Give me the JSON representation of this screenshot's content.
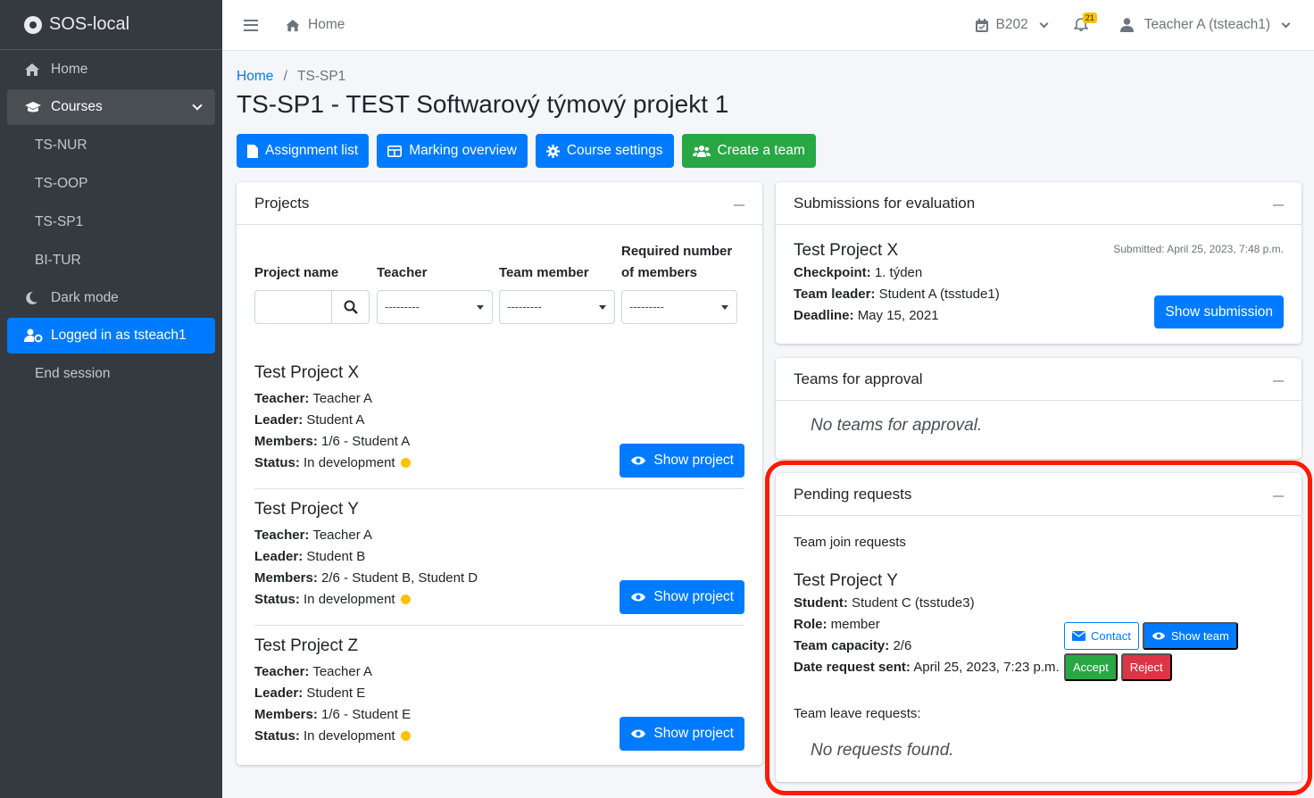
{
  "sidebar": {
    "brand": "SOS-local",
    "items": [
      {
        "label": "Home",
        "icon": "home-icon"
      },
      {
        "label": "Courses",
        "icon": "graduation-cap-icon"
      },
      {
        "label": "TS-NUR"
      },
      {
        "label": "TS-OOP"
      },
      {
        "label": "TS-SP1"
      },
      {
        "label": "BI-TUR"
      },
      {
        "label": "Dark mode",
        "icon": "moon-icon"
      },
      {
        "label": "Logged in as tsteach1",
        "icon": "user-cog-icon"
      },
      {
        "label": "End session"
      }
    ]
  },
  "topbar": {
    "home_label": "Home",
    "room": "B202",
    "notifications_count": "21",
    "user": "Teacher A (tsteach1)"
  },
  "breadcrumb": {
    "home": "Home",
    "current": "TS-SP1"
  },
  "page_title": "TS-SP1 - TEST Softwarový týmový projekt 1",
  "actions": {
    "assignment_list": "Assignment list",
    "marking_overview": "Marking overview",
    "course_settings": "Course settings",
    "create_team": "Create a team"
  },
  "projects": {
    "title": "Projects",
    "filters": {
      "project_name": "Project name",
      "teacher": "Teacher",
      "team_member": "Team member",
      "required_line1": "Required number",
      "required_line2": "of members",
      "placeholder": "---------"
    },
    "labels": {
      "teacher": "Teacher:",
      "leader": "Leader:",
      "members": "Members:",
      "status": "Status:"
    },
    "show_label": "Show project",
    "list": [
      {
        "name": "Test Project X",
        "teacher": "Teacher A",
        "leader": "Student A",
        "members": "1/6 - Student A",
        "status": "In development"
      },
      {
        "name": "Test Project Y",
        "teacher": "Teacher A",
        "leader": "Student B",
        "members": "2/6 - Student B, Student D",
        "status": "In development"
      },
      {
        "name": "Test Project Z",
        "teacher": "Teacher A",
        "leader": "Student E",
        "members": "1/6 - Student E",
        "status": "In development"
      }
    ]
  },
  "submissions": {
    "title": "Submissions for evaluation",
    "project": "Test Project X",
    "submitted": "Submitted: April 25, 2023, 7:48 p.m.",
    "checkpoint_label": "Checkpoint:",
    "checkpoint": "1. týden",
    "leader_label": "Team leader:",
    "leader": "Student A (tsstude1)",
    "deadline_label": "Deadline:",
    "deadline": "May 15, 2021",
    "button": "Show submission"
  },
  "approval": {
    "title": "Teams for approval",
    "empty": "No teams for approval."
  },
  "pending": {
    "title": "Pending requests",
    "join_title": "Team join requests",
    "project": "Test Project Y",
    "student_label": "Student:",
    "student": "Student C (tsstude3)",
    "role_label": "Role:",
    "role": "member",
    "capacity_label": "Team capacity:",
    "capacity": "2/6",
    "date_label": "Date request sent:",
    "date": "April 25, 2023, 7:23 p.m.",
    "contact": "Contact",
    "show_team": "Show team",
    "accept": "Accept",
    "reject": "Reject",
    "leave_title": "Team leave requests:",
    "leave_empty": "No requests found."
  },
  "colors": {
    "primary": "#007bff",
    "success": "#28a745",
    "danger": "#dc3545",
    "warning": "#ffc107",
    "sidebar": "#343a40",
    "highlight": "#ff1a00"
  }
}
